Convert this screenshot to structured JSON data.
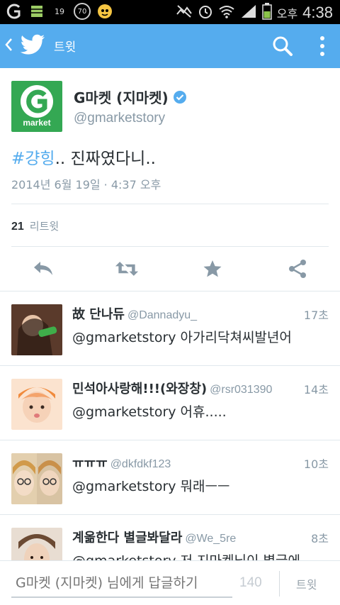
{
  "status_bar": {
    "left_icons": [
      "g-app-icon",
      "sheet-icon",
      "weather-icon",
      "clock-badge-icon",
      "mascot-icon"
    ],
    "weather_text": "19",
    "clock_badge_text": "70",
    "ampm": "오후",
    "time": "4:38"
  },
  "app_bar": {
    "title": "트윗"
  },
  "tweet": {
    "author_name": "G마켓 (지마켓)",
    "author_handle": "@gmarketstory",
    "avatar_label": "market",
    "hashtag": "#걍힝",
    "text_rest": ".. 진짜였다니..",
    "date": "2014년 6월 19일 · 4:37 오후",
    "retweet_count": "21",
    "retweet_label": "리트윗"
  },
  "replies": [
    {
      "name": "故 단나듀",
      "handle": "@Dannadyu_",
      "time": "17초",
      "text": "@gmarketstory 아가리닥쳐씨발년어",
      "avatar_color": "#6b4a3a"
    },
    {
      "name": "민석아사랑해!!!(와장창)",
      "handle": "@rsr031390",
      "time": "14초",
      "text": "@gmarketstory 어휴.....",
      "avatar_color": "#f3b98c"
    },
    {
      "name": "ㅠㅠㅠ",
      "handle": "@dkfdkf123",
      "time": "10초",
      "text": "@gmarketstory 뭐래ㅡㅡ",
      "avatar_color": "#c9a57a"
    },
    {
      "name": "계옮한다 별글봐달라",
      "handle": "@We_5re",
      "time": "8초",
      "text": "@gmarketstory 저 지마켓님이 별글에",
      "avatar_color": "#a48670"
    }
  ],
  "compose": {
    "placeholder": "G마켓 (지마켓) 님에게 답글하기",
    "counter": "140",
    "send_label": "트윗"
  },
  "colors": {
    "accent": "#55acee",
    "gmarket_green": "#34a853",
    "verified": "#55acee"
  }
}
